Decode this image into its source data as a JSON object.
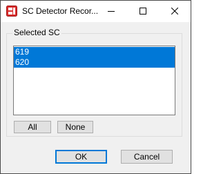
{
  "window": {
    "title": "SC Detector Recor...",
    "accent_color": "#0078d7"
  },
  "titlebar_buttons": {
    "minimize_icon": "minimize-icon",
    "maximize_icon": "maximize-icon",
    "close_icon": "close-icon"
  },
  "group": {
    "label": "Selected SC",
    "items": [
      {
        "label": "619",
        "selected": true
      },
      {
        "label": "620",
        "selected": true
      }
    ],
    "all_label": "All",
    "none_label": "None"
  },
  "footer": {
    "ok_label": "OK",
    "cancel_label": "Cancel"
  }
}
